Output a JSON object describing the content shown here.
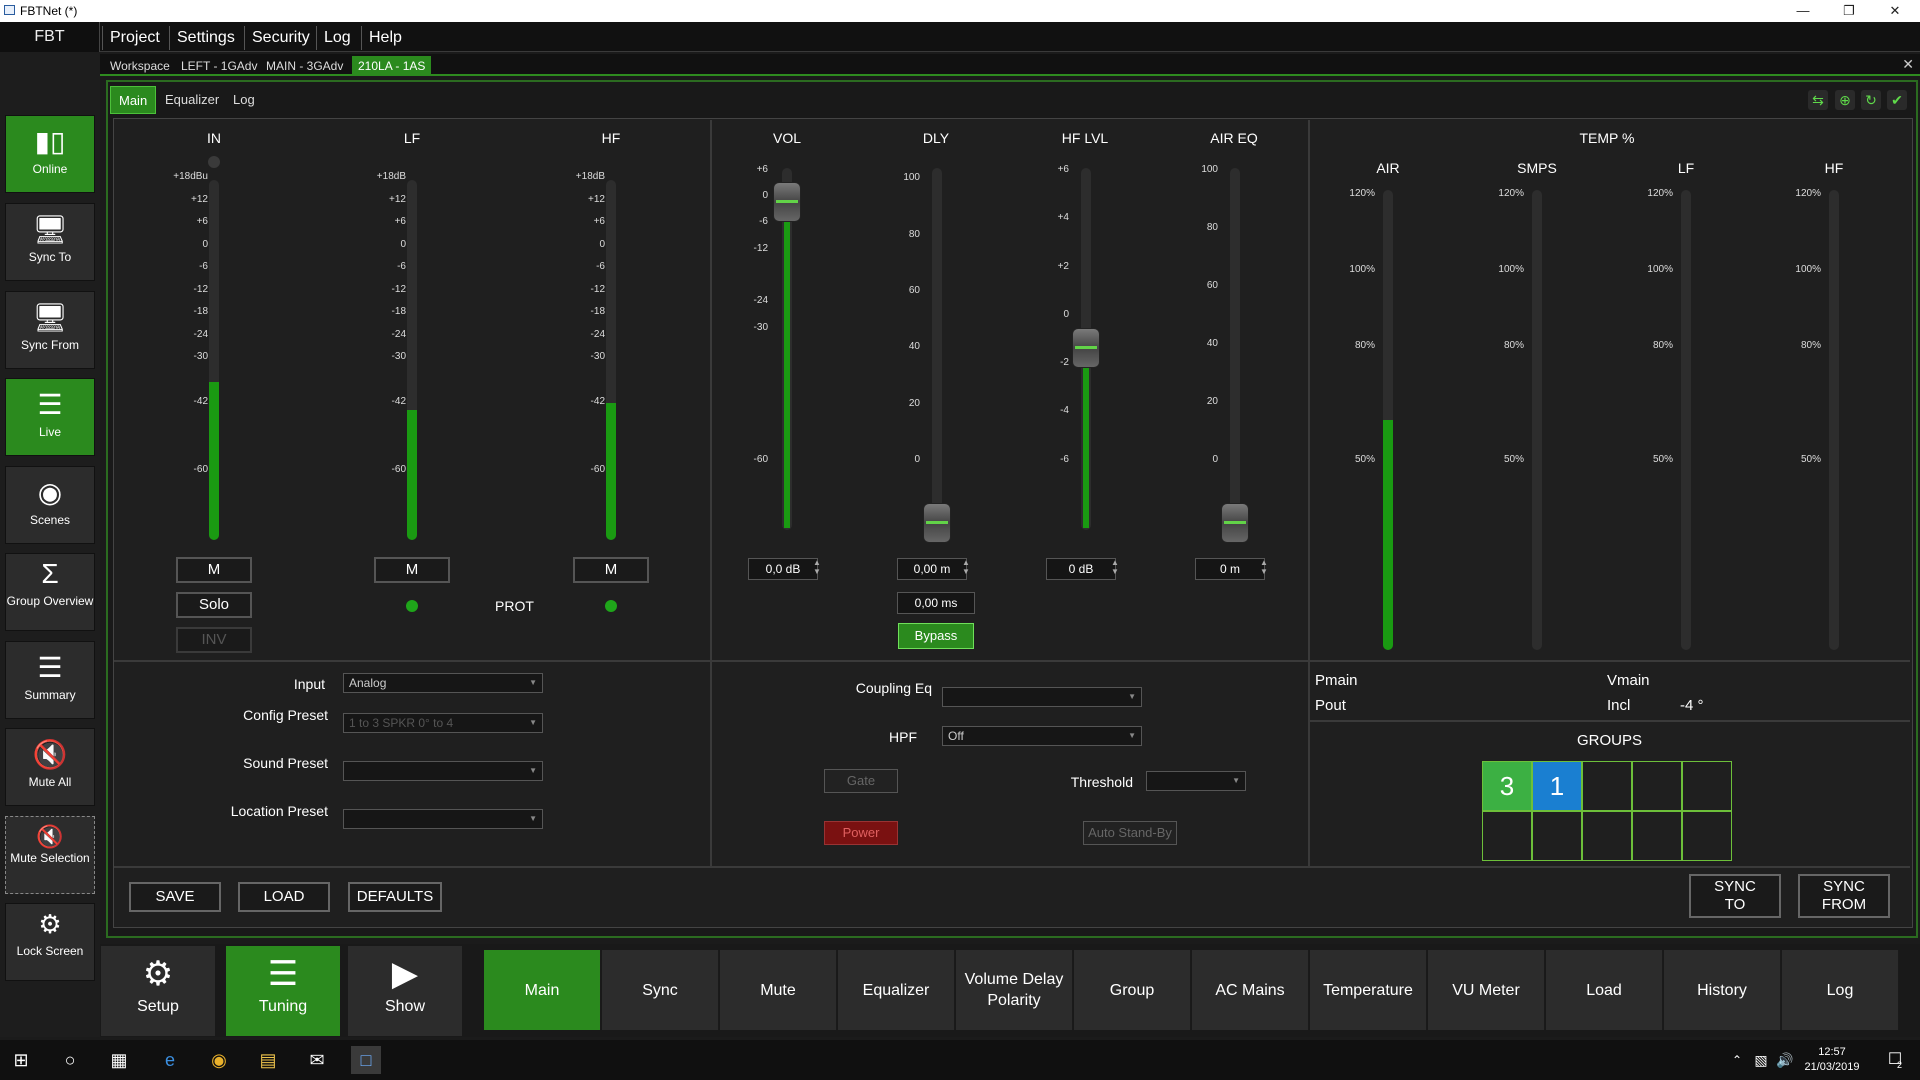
{
  "window": {
    "title": "FBTNet (*)"
  },
  "menu": {
    "brand": "FBT",
    "items": [
      "Project",
      "Settings",
      "Security",
      "Log",
      "Help"
    ]
  },
  "sidebar": {
    "items": [
      {
        "label": "Online",
        "icon": "online-bars-icon",
        "active": true
      },
      {
        "label": "Sync To",
        "icon": "sync-to-icon",
        "active": false
      },
      {
        "label": "Sync From",
        "icon": "sync-from-icon",
        "active": false
      },
      {
        "label": "Live",
        "icon": "sliders-icon",
        "active": true
      },
      {
        "label": "Scenes",
        "icon": "camera-icon",
        "active": false
      },
      {
        "label": "Group Overview",
        "icon": "sigma-icon",
        "active": false
      },
      {
        "label": "Summary",
        "icon": "list-icon",
        "active": false
      },
      {
        "label": "Mute All",
        "icon": "mute-icon",
        "active": false
      },
      {
        "label": "Mute Selection",
        "icon": "mute-selection-icon",
        "active": false
      },
      {
        "label": "Lock Screen",
        "icon": "lock-icon",
        "active": false
      }
    ]
  },
  "workspace_tabs": [
    "Workspace",
    "LEFT - 1GAdv",
    "MAIN - 3GAdv",
    "210LA - 1AS"
  ],
  "sub_tabs": [
    "Main",
    "Equalizer",
    "Log"
  ],
  "meters": {
    "in": {
      "title": "IN",
      "ticks": [
        "+18dBu",
        "+12",
        "+6",
        "0",
        "-6",
        "-12",
        "-18",
        "-24",
        "-30",
        "-42",
        "-60"
      ],
      "level": 0.44
    },
    "lf": {
      "title": "LF",
      "ticks": [
        "+18dB",
        "+12",
        "+6",
        "0",
        "-6",
        "-12",
        "-18",
        "-24",
        "-30",
        "-42",
        "-60"
      ],
      "level": 0.36
    },
    "hf": {
      "title": "HF",
      "ticks": [
        "+18dB",
        "+12",
        "+6",
        "0",
        "-6",
        "-12",
        "-18",
        "-24",
        "-30",
        "-42",
        "-60"
      ],
      "level": 0.38
    },
    "mute_label": "M",
    "solo_label": "Solo",
    "inv_label": "INV",
    "prot_label": "PROT"
  },
  "faders": {
    "vol": {
      "title": "VOL",
      "ticks": [
        "+6",
        "0",
        "-6",
        "-12",
        "-24",
        "-30",
        "-60"
      ],
      "value": "0,0 dB"
    },
    "dly": {
      "title": "DLY",
      "ticks": [
        "100",
        "80",
        "60",
        "40",
        "20",
        "0"
      ],
      "value": "0,00 m",
      "value2": "0,00 ms",
      "bypass": "Bypass"
    },
    "hflvl": {
      "title": "HF LVL",
      "ticks": [
        "+6",
        "+4",
        "+2",
        "0",
        "-2",
        "-4",
        "-6"
      ],
      "value": "0 dB"
    },
    "aireq": {
      "title": "AIR EQ",
      "ticks": [
        "100",
        "80",
        "60",
        "40",
        "20",
        "0"
      ],
      "value": "0 m"
    }
  },
  "temp": {
    "title": "TEMP %",
    "columns": [
      {
        "label": "AIR",
        "level": 0.5
      },
      {
        "label": "SMPS",
        "level": 0
      },
      {
        "label": "LF",
        "level": 0
      },
      {
        "label": "HF",
        "level": 0
      }
    ],
    "ticks": [
      "120%",
      "100%",
      "80%",
      "50%"
    ]
  },
  "config": {
    "input_label": "Input",
    "input_value": "Analog",
    "config_preset_label": "Config Preset",
    "config_preset_value": "1 to 3 SPKR 0° to 4",
    "sound_preset_label": "Sound Preset",
    "sound_preset_value": "",
    "location_preset_label": "Location Preset",
    "location_preset_value": ""
  },
  "processing": {
    "coupling_label": "Coupling Eq",
    "coupling_value": "",
    "hpf_label": "HPF",
    "hpf_value": "Off",
    "gate_label": "Gate",
    "threshold_label": "Threshold",
    "threshold_value": "",
    "power_label": "Power",
    "autostandby_label": "Auto Stand-By"
  },
  "status": {
    "pmain_label": "Pmain",
    "vmain_label": "Vmain",
    "pout_label": "Pout",
    "incl_label": "Incl",
    "incl_value": "-4 °",
    "groups_label": "GROUPS",
    "groups": [
      {
        "value": "3",
        "color": "#3cb043"
      },
      {
        "value": "1",
        "color": "#1a7fd1"
      },
      {
        "value": "",
        "color": ""
      },
      {
        "value": "",
        "color": ""
      },
      {
        "value": "",
        "color": ""
      },
      {
        "value": "",
        "color": ""
      },
      {
        "value": "",
        "color": ""
      },
      {
        "value": "",
        "color": ""
      },
      {
        "value": "",
        "color": ""
      },
      {
        "value": "",
        "color": ""
      }
    ]
  },
  "actions": {
    "save": "SAVE",
    "load": "LOAD",
    "defaults": "DEFAULTS",
    "sync_to_1": "SYNC",
    "sync_to_2": "TO",
    "sync_from_1": "SYNC",
    "sync_from_2": "FROM"
  },
  "bottom": {
    "modes": [
      {
        "label": "Setup",
        "icon": "gear-icon",
        "active": false
      },
      {
        "label": "Tuning",
        "icon": "tuning-sliders-icon",
        "active": true
      },
      {
        "label": "Show",
        "icon": "play-icon",
        "active": false
      }
    ],
    "tabs": [
      "Main",
      "Sync",
      "Mute",
      "Equalizer",
      "Volume Delay Polarity",
      "Group",
      "AC Mains",
      "Temperature",
      "VU Meter",
      "Load",
      "History",
      "Log"
    ]
  },
  "taskbar": {
    "time": "12:57",
    "date": "21/03/2019",
    "notifications": "2"
  },
  "colors": {
    "accent": "#2b8a1e",
    "meter": "#1a9a12",
    "group_blue": "#1a7fd1"
  }
}
